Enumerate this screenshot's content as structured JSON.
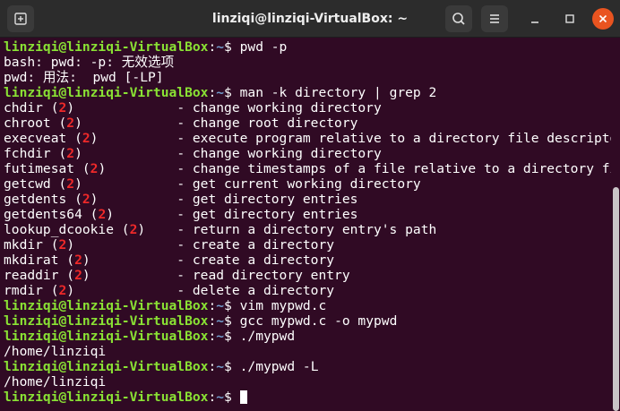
{
  "window": {
    "title": "linziqi@linziqi-VirtualBox: ~"
  },
  "colors": {
    "background": "#300a24",
    "user": "#8ae234",
    "path": "#729fcf",
    "section": "#ef2929",
    "close": "#e95420"
  },
  "icons": {
    "new_tab": "new-tab-icon",
    "search": "search-icon",
    "menu": "hamburger-menu-icon",
    "minimize": "minimize-icon",
    "maximize": "maximize-icon",
    "close": "close-icon"
  },
  "terminal": {
    "lines": [
      {
        "type": "prompt",
        "user": "linziqi@linziqi-VirtualBox",
        "path": "~",
        "cmd": " pwd -p"
      },
      {
        "type": "output",
        "text": "bash: pwd: -p: 无效选项"
      },
      {
        "type": "output",
        "text": "pwd: 用法:  pwd [-LP]"
      },
      {
        "type": "prompt",
        "user": "linziqi@linziqi-VirtualBox",
        "path": "~",
        "cmd": " man -k directory | grep 2"
      },
      {
        "type": "man",
        "name": "chdir (",
        "num": "2",
        "rest": ")             - change working directory"
      },
      {
        "type": "man",
        "name": "chroot (",
        "num": "2",
        "rest": ")            - change root directory"
      },
      {
        "type": "man",
        "name": "execveat (",
        "num": "2",
        "rest": ")          - execute program relative to a directory file descriptor"
      },
      {
        "type": "man",
        "name": "fchdir (",
        "num": "2",
        "rest": ")            - change working directory"
      },
      {
        "type": "man",
        "name": "futimesat (",
        "num": "2",
        "rest": ")         - change timestamps of a file relative to a directory fi..."
      },
      {
        "type": "man",
        "name": "getcwd (",
        "num": "2",
        "rest": ")            - get current working directory"
      },
      {
        "type": "man",
        "name": "getdents (",
        "num": "2",
        "rest": ")          - get directory entries"
      },
      {
        "type": "man",
        "name": "getdents64 (",
        "num": "2",
        "rest": ")        - get directory entries"
      },
      {
        "type": "man",
        "name": "lookup_dcookie (",
        "num": "2",
        "rest": ")    - return a directory entry's path"
      },
      {
        "type": "man",
        "name": "mkdir (",
        "num": "2",
        "rest": ")             - create a directory"
      },
      {
        "type": "man",
        "name": "mkdirat (",
        "num": "2",
        "rest": ")           - create a directory"
      },
      {
        "type": "man",
        "name": "readdir (",
        "num": "2",
        "rest": ")           - read directory entry"
      },
      {
        "type": "man",
        "name": "rmdir (",
        "num": "2",
        "rest": ")             - delete a directory"
      },
      {
        "type": "prompt",
        "user": "linziqi@linziqi-VirtualBox",
        "path": "~",
        "cmd": " vim mypwd.c"
      },
      {
        "type": "prompt",
        "user": "linziqi@linziqi-VirtualBox",
        "path": "~",
        "cmd": " gcc mypwd.c -o mypwd"
      },
      {
        "type": "prompt",
        "user": "linziqi@linziqi-VirtualBox",
        "path": "~",
        "cmd": " ./mypwd"
      },
      {
        "type": "output",
        "text": "/home/linziqi"
      },
      {
        "type": "prompt",
        "user": "linziqi@linziqi-VirtualBox",
        "path": "~",
        "cmd": " ./mypwd -L"
      },
      {
        "type": "output",
        "text": "/home/linziqi"
      },
      {
        "type": "prompt",
        "user": "linziqi@linziqi-VirtualBox",
        "path": "~",
        "cmd": " ",
        "cursor": true
      }
    ]
  }
}
